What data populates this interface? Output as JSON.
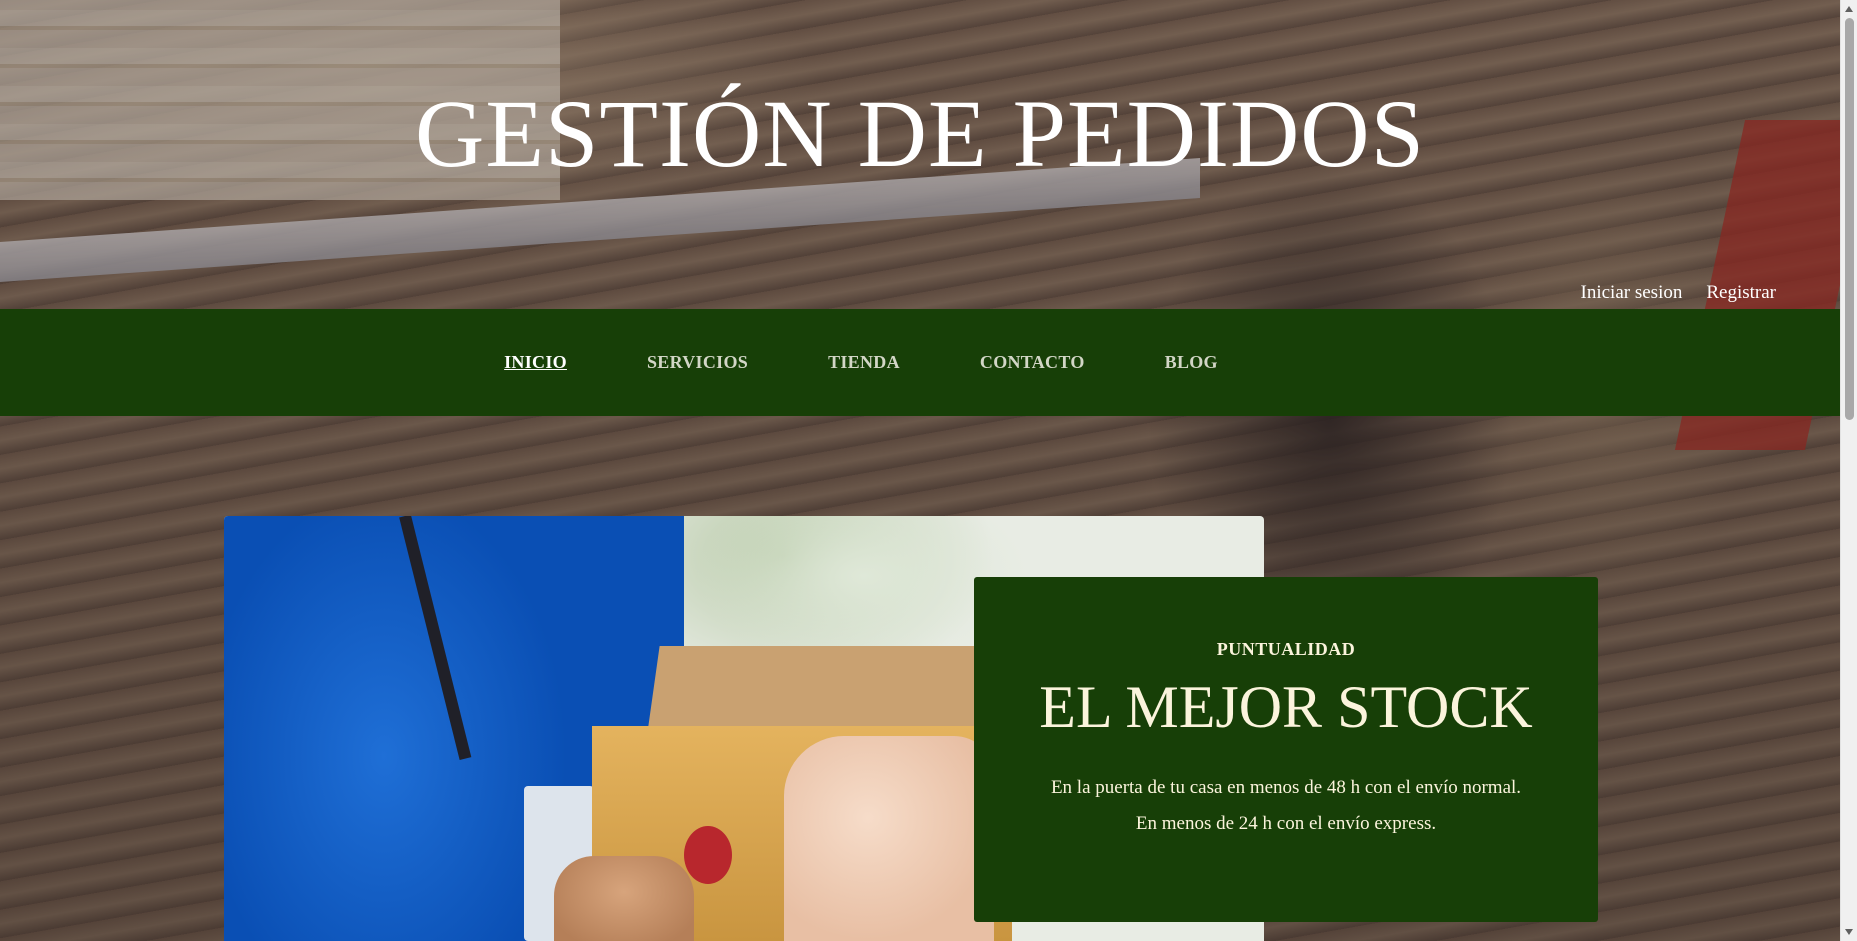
{
  "header": {
    "title": "GESTIÓN DE PEDIDOS",
    "auth": {
      "login_label": "Iniciar sesion",
      "register_label": "Registrar"
    }
  },
  "nav": {
    "items": [
      {
        "label": "INICIO",
        "active": true
      },
      {
        "label": "SERVICIOS",
        "active": false
      },
      {
        "label": "TIENDA",
        "active": false
      },
      {
        "label": "CONTACTO",
        "active": false
      },
      {
        "label": "BLOG",
        "active": false
      }
    ]
  },
  "hero_card": {
    "kicker": "PUNTUALIDAD",
    "headline": "EL MEJOR STOCK",
    "line1": "En la puerta de tu casa en menos de 48 h con el envío normal.",
    "line2": "En menos de 24 h con el envío express."
  },
  "colors": {
    "nav_background": "#173f07",
    "card_background": "#173f07",
    "card_text": "#fbf4dc",
    "title_text": "#ffffff"
  },
  "icons": {
    "scroll_up": "triangle-up",
    "scroll_down": "triangle-down"
  }
}
